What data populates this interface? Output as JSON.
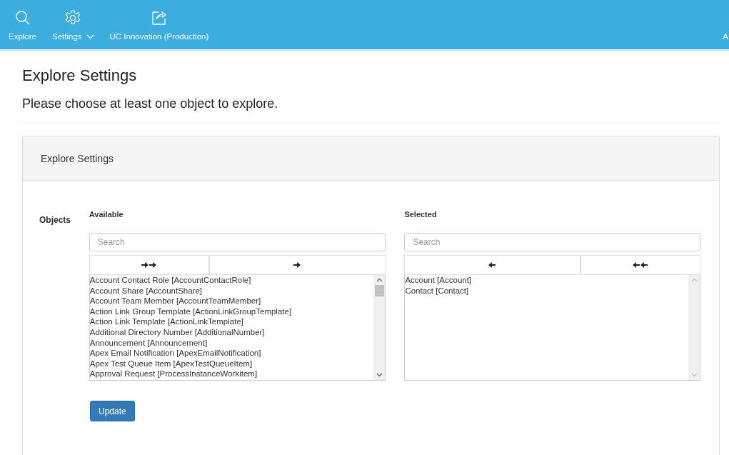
{
  "nav": {
    "items": [
      {
        "kind": "search",
        "label": "Explore"
      },
      {
        "kind": "gear",
        "label": "Settings",
        "dropdown": true
      },
      {
        "kind": "share",
        "label": "UC Innovation (Production)"
      }
    ],
    "right_label": "A"
  },
  "page": {
    "title": "Explore Settings",
    "subtitle": "Please choose at least one object to explore."
  },
  "panel": {
    "heading": "Explore Settings",
    "field_label": "Objects",
    "available": {
      "label": "Available",
      "placeholder": "Search",
      "buttons": [
        {
          "kind": "all-right"
        },
        {
          "kind": "right"
        }
      ],
      "items": [
        "Account Contact Role [AccountContactRole]",
        "Account Share [AccountShare]",
        "Account Team Member [AccountTeamMember]",
        "Action Link Group Template [ActionLinkGroupTemplate]",
        "Action Link Template [ActionLinkTemplate]",
        "Additional Directory Number [AdditionalNumber]",
        "Announcement [Announcement]",
        "Apex Email Notification [ApexEmailNotification]",
        "Apex Test Queue Item [ApexTestQueueItem]",
        "Approval Request [ProcessInstanceWorkitem]"
      ]
    },
    "selected": {
      "label": "Selected",
      "placeholder": "Search",
      "buttons": [
        {
          "kind": "left"
        },
        {
          "kind": "all-left"
        }
      ],
      "items": [
        "Account [Account]",
        "Contact [Contact]"
      ]
    },
    "button": "Update"
  }
}
